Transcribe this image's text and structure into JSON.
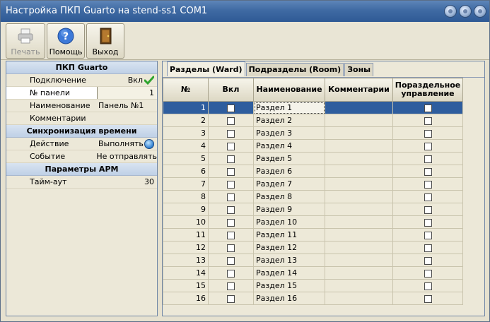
{
  "window": {
    "title": "Настройка  ПКП Guarto на stend-ss1 COM1"
  },
  "toolbar": {
    "print_label": "Печать",
    "help_label": "Помощь",
    "exit_label": "Выход"
  },
  "properties": {
    "section1_title": "ПКП Guarto",
    "connection_label": "Подключение",
    "connection_value": "Вкл",
    "panel_num_label": "№ панели",
    "panel_num_value": "1",
    "name_label": "Наименование",
    "name_value": "Панель №1",
    "comment_label": "Комментарии",
    "comment_value": "",
    "section2_title": "Синхронизация времени",
    "action_label": "Действие",
    "action_value": "Выполнять",
    "event_label": "Событие",
    "event_value": "Не отправлять",
    "section3_title": "Параметры АРМ",
    "timeout_label": "Тайм-аут",
    "timeout_value": "30"
  },
  "tabs": [
    "Разделы (Ward)",
    "Подразделы (Room)",
    "Зоны"
  ],
  "grid": {
    "headers": [
      "№",
      "Вкл",
      "Наименование",
      "Комментарии",
      "Пораздельное управление"
    ],
    "rows": [
      {
        "num": "1",
        "name": "Раздел 1"
      },
      {
        "num": "2",
        "name": "Раздел 2"
      },
      {
        "num": "3",
        "name": "Раздел 3"
      },
      {
        "num": "4",
        "name": "Раздел 4"
      },
      {
        "num": "5",
        "name": "Раздел 5"
      },
      {
        "num": "6",
        "name": "Раздел 6"
      },
      {
        "num": "7",
        "name": "Раздел 7"
      },
      {
        "num": "8",
        "name": "Раздел 8"
      },
      {
        "num": "9",
        "name": "Раздел 9"
      },
      {
        "num": "10",
        "name": "Раздел 10"
      },
      {
        "num": "11",
        "name": "Раздел 11"
      },
      {
        "num": "12",
        "name": "Раздел 12"
      },
      {
        "num": "13",
        "name": "Раздел 13"
      },
      {
        "num": "14",
        "name": "Раздел 14"
      },
      {
        "num": "15",
        "name": "Раздел 15"
      },
      {
        "num": "16",
        "name": "Раздел 16"
      }
    ]
  },
  "colors": {
    "titlebar": "#3f6aa3",
    "selection": "#2e5d9e",
    "ok_check": "#2fa52f"
  }
}
